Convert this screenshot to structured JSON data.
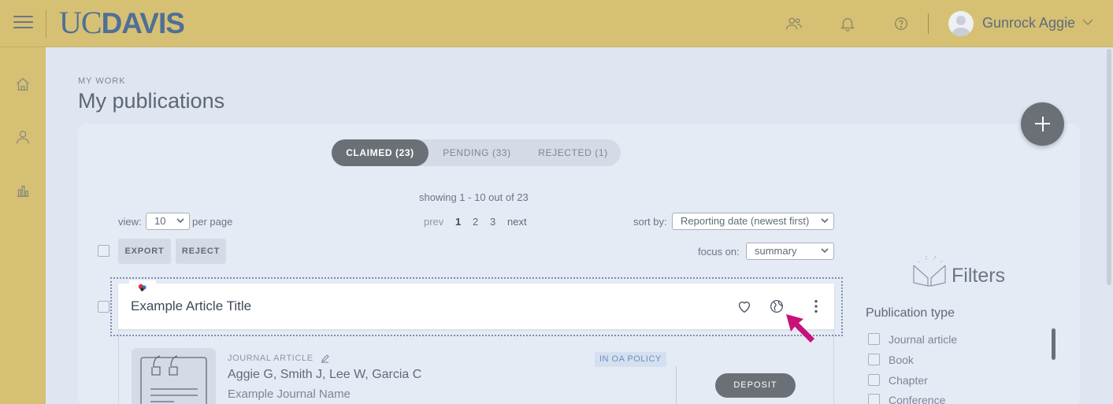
{
  "header": {
    "logo_uc": "UC",
    "logo_davis": "DAVIS",
    "user_name": "Gunrock Aggie"
  },
  "sidebar": {
    "items": [
      {
        "icon": "home-icon"
      },
      {
        "icon": "person-icon"
      },
      {
        "icon": "bar-chart-icon"
      }
    ]
  },
  "page": {
    "breadcrumb": "MY WORK",
    "title": "My publications"
  },
  "tabs": [
    {
      "label": "CLAIMED (23)",
      "active": true
    },
    {
      "label": "PENDING (33)",
      "active": false
    },
    {
      "label": "REJECTED (1)",
      "active": false
    }
  ],
  "listing": {
    "showing": "showing 1 - 10 out of 23",
    "view_label": "view:",
    "view_value": "10",
    "per_page": "per page",
    "prev": "prev",
    "pages": [
      "1",
      "2",
      "3"
    ],
    "current_page": "1",
    "next": "next",
    "sort_label": "sort by:",
    "sort_value": "Reporting date (newest first)",
    "focus_label": "focus on:",
    "focus_value": "summary",
    "export_label": "EXPORT",
    "reject_label": "REJECT"
  },
  "card": {
    "title": "Example Article Title",
    "pub_type": "JOURNAL ARTICLE",
    "authors": "Aggie G, Smith J, Lee W, Garcia C",
    "journal": "Example Journal Name",
    "oa_badge": "IN OA POLICY",
    "deposit_label": "DEPOSIT"
  },
  "filters": {
    "title": "Filters",
    "section": "Publication type",
    "options": [
      "Journal article",
      "Book",
      "Chapter",
      "Conference"
    ]
  },
  "colors": {
    "topbar": "#d6c074",
    "brand_blue": "#4f6f98",
    "accent_arrow": "#c8117a",
    "dark_button": "#6b7077"
  }
}
